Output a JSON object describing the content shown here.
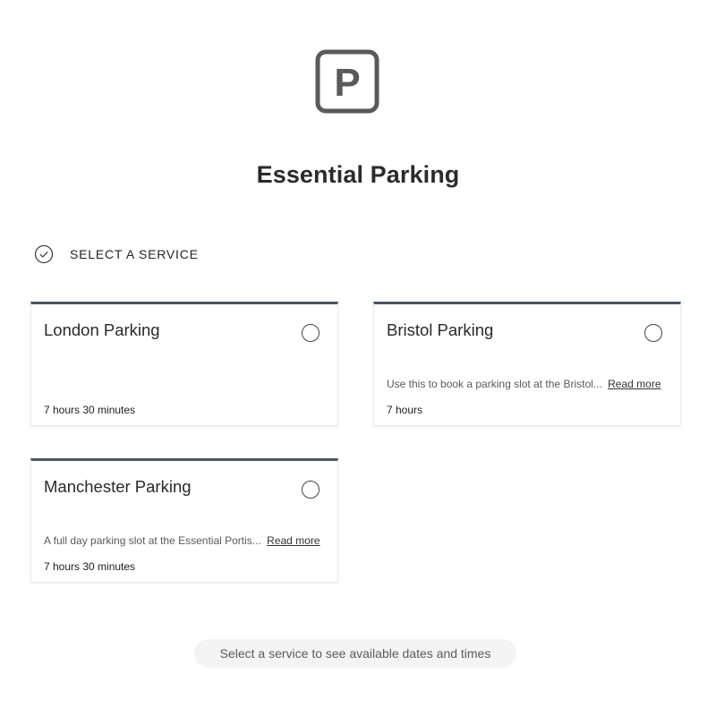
{
  "app": {
    "title": "Essential Parking"
  },
  "section": {
    "label": "SELECT A SERVICE"
  },
  "services": [
    {
      "name": "London Parking",
      "description": "",
      "read_more": "",
      "duration": "7 hours 30 minutes"
    },
    {
      "name": "Bristol Parking",
      "description": "Use this to book a parking slot at the Bristol...",
      "read_more": "Read more",
      "duration": "7 hours"
    },
    {
      "name": "Manchester Parking",
      "description": "A full day parking slot at the Essential Portis...",
      "read_more": "Read more",
      "duration": "7 hours 30 minutes"
    }
  ],
  "footer": {
    "hint": "Select a service to see available dates and times"
  },
  "colors": {
    "card_accent": "#4a5463",
    "text": "#252525",
    "muted": "#5a5a5a",
    "hint_bg": "#f4f4f4"
  },
  "icons": {
    "logo": "parking-p-icon",
    "section": "checkmark-circle-icon",
    "select": "radio-circle-icon"
  }
}
